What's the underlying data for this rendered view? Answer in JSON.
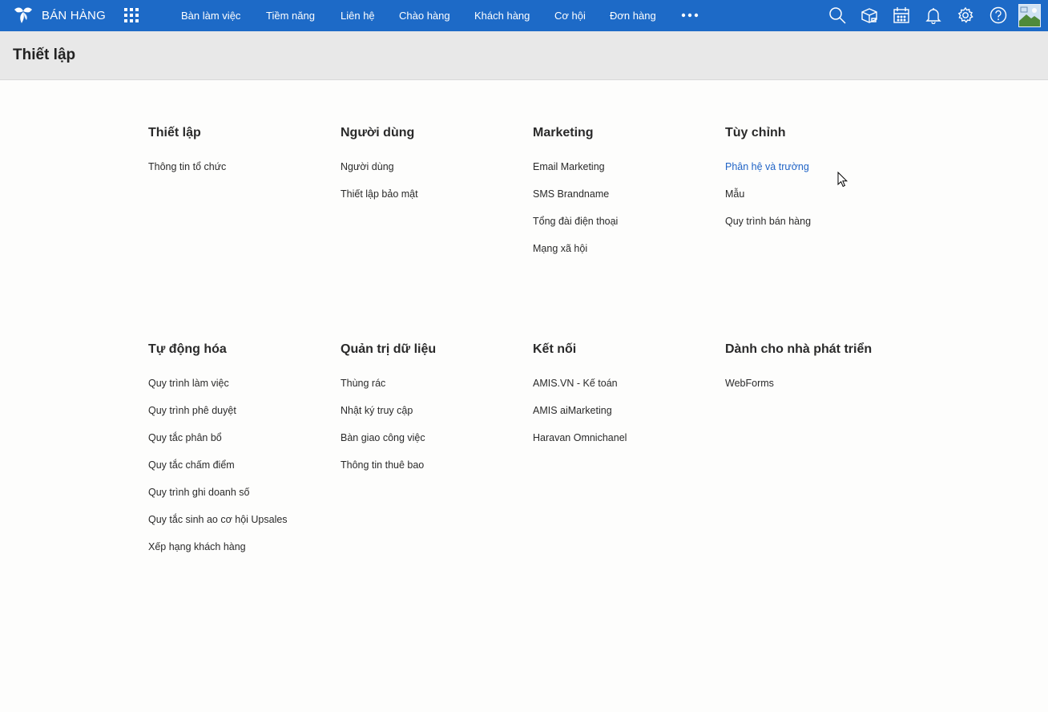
{
  "app": {
    "name": "BÁN HÀNG"
  },
  "nav": [
    "Bàn làm việc",
    "Tiềm năng",
    "Liên hệ",
    "Chào hàng",
    "Khách hàng",
    "Cơ hội",
    "Đơn hàng"
  ],
  "icons": {
    "logo": "bird-logo-icon",
    "apps": "apps-grid-icon",
    "more": "more-dots-icon",
    "toolbar": [
      "search-icon",
      "package-icon",
      "calendar-icon",
      "bell-icon",
      "gear-icon",
      "help-icon"
    ]
  },
  "colors": {
    "topbar": "#1d6ac7",
    "link_active": "#1f63c6",
    "header_bg": "#e8e8e8"
  },
  "page": {
    "title": "Thiết lập"
  },
  "sections": [
    {
      "title": "Thiết lập",
      "items": [
        "Thông tin tổ chức"
      ]
    },
    {
      "title": "Người dùng",
      "items": [
        "Người dùng",
        "Thiết lập bảo mật"
      ]
    },
    {
      "title": "Marketing",
      "items": [
        "Email Marketing",
        "SMS Brandname",
        "Tổng đài điện thoại",
        "Mạng xã hội"
      ]
    },
    {
      "title": "Tùy chỉnh",
      "items": [
        "Phân hệ và trường",
        "Mẫu",
        "Quy trình bán hàng"
      ]
    },
    {
      "title": "Tự động hóa",
      "items": [
        "Quy trình làm việc",
        "Quy trình phê duyệt",
        "Quy tắc phân bổ",
        "Quy tắc chấm điểm",
        "Quy trình ghi doanh số",
        "Quy tắc sinh ao cơ hội Upsales",
        "Xếp hạng khách hàng"
      ]
    },
    {
      "title": "Quản trị dữ liệu",
      "items": [
        "Thùng rác",
        "Nhật ký truy cập",
        "Bàn giao công việc",
        "Thông tin thuê bao"
      ]
    },
    {
      "title": "Kết nối",
      "items": [
        "AMIS.VN - Kế toán",
        "AMIS aiMarketing",
        "Haravan Omnichanel"
      ]
    },
    {
      "title": "Dành cho nhà phát triển",
      "items": [
        "WebForms"
      ]
    }
  ]
}
